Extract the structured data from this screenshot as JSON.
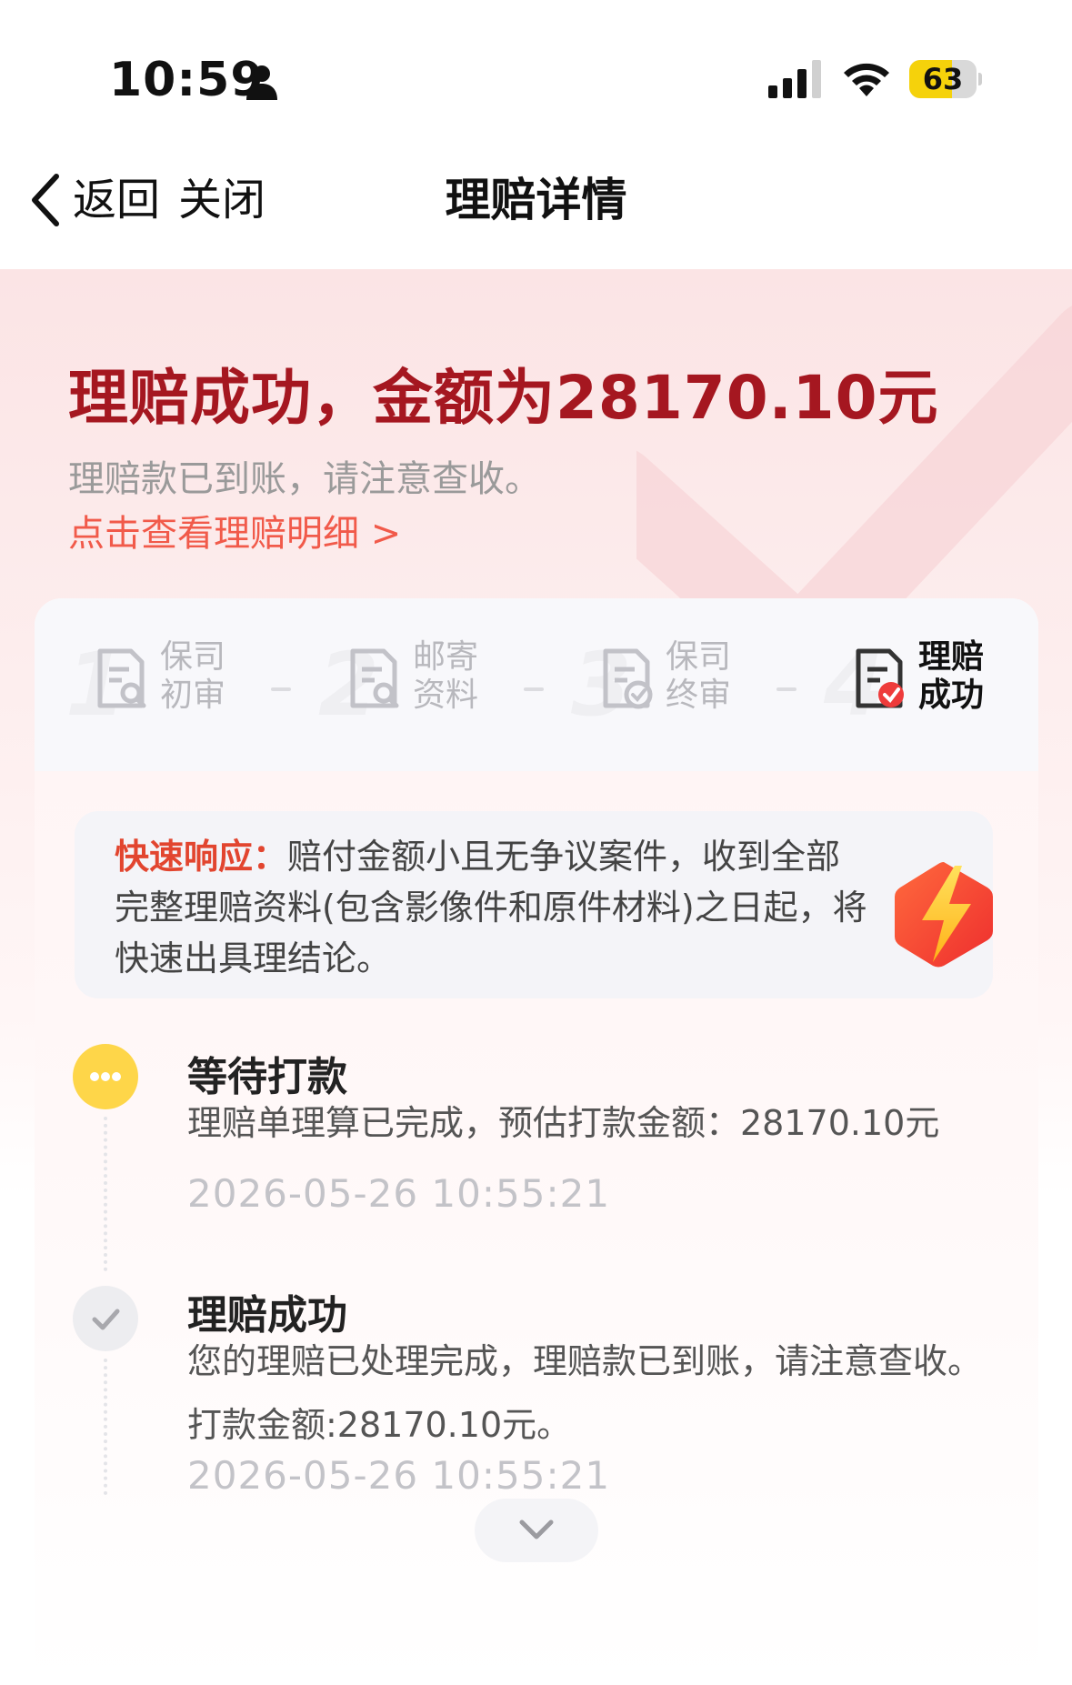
{
  "status_bar": {
    "time": "10:59",
    "battery_percent": 63,
    "battery_label": "63",
    "icons": [
      "person-icon",
      "signal-icon",
      "wifi-icon",
      "battery-icon"
    ]
  },
  "nav": {
    "back_label": "返回",
    "close_label": "关闭",
    "title": "理赔详情"
  },
  "hero": {
    "title": "理赔成功，金额为28170.10元",
    "subtitle": "理赔款已到账，请注意查收。",
    "detail_link": "点击查看理赔明细 >"
  },
  "steps": [
    {
      "num": "1",
      "label_line1": "保司",
      "label_line2": "初审",
      "active": false,
      "icon": "document-search-icon"
    },
    {
      "num": "2",
      "label_line1": "邮寄",
      "label_line2": "资料",
      "active": false,
      "icon": "document-search-icon"
    },
    {
      "num": "3",
      "label_line1": "保司",
      "label_line2": "终审",
      "active": false,
      "icon": "document-check-icon"
    },
    {
      "num": "4",
      "label_line1": "理赔",
      "label_line2": "成功",
      "active": true,
      "icon": "document-check-red-icon"
    }
  ],
  "notice": {
    "key": "快速响应：",
    "text": "赔付金额小且无争议案件，收到全部完整理赔资料(包含影像件和原件材料)之日起，将快速出具理结论。",
    "icon": "lightning-icon"
  },
  "timeline": [
    {
      "title": "等待打款",
      "desc": "理赔单理算已完成，预估打款金额：28170.10元",
      "time": "2026-05-26 10:55:21",
      "icon": "more-dots-icon",
      "color": "#fed649"
    },
    {
      "title": "理赔成功",
      "desc": "您的理赔已处理完成，理赔款已到账，请注意查收。打款金额:28170.10元。",
      "time": "2026-05-26 10:55:21",
      "icon": "check-icon",
      "color": "#ededf0"
    }
  ],
  "colors": {
    "accent_red": "#a51720",
    "link_red": "#f15a4a",
    "notice_red": "#e2452f",
    "pending_yellow": "#fed649"
  }
}
